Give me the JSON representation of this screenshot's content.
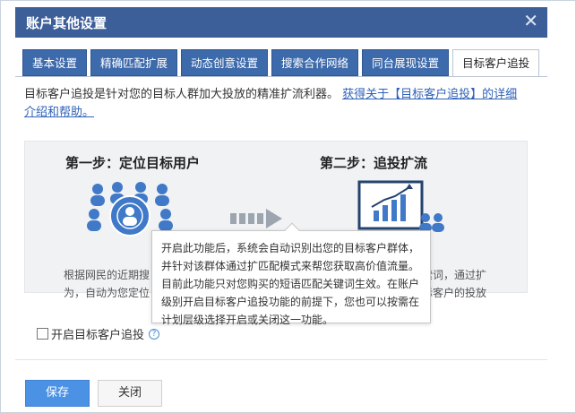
{
  "window": {
    "title": "账户其他设置",
    "close_glyph": "✕"
  },
  "tabs": [
    {
      "label": "基本设置",
      "active": false
    },
    {
      "label": "精确匹配扩展",
      "active": false
    },
    {
      "label": "动态创意设置",
      "active": false
    },
    {
      "label": "搜索合作网络",
      "active": false
    },
    {
      "label": "同台展现设置",
      "active": false
    },
    {
      "label": "目标客户追投",
      "active": true
    }
  ],
  "intro": {
    "text": "目标客户追投是针对您的目标人群加大投放的精准扩流利器。",
    "link": "获得关于【目标客户追投】的详细介绍和帮助。"
  },
  "steps": {
    "step1_title": "第一步：定位目标用户",
    "step2_title": "第二步：追投扩流",
    "left_desc_line1": "根据网民的近期搜",
    "left_desc_line2": "为，自动为您定位",
    "right_desc_line1": "索词，通过扩",
    "right_desc_line2": "标客户的投放"
  },
  "tooltip": {
    "lines": [
      "开启此功能后，系统会自动识别出您的目标客户群体，",
      "并针对该群体通过扩匹配模式来帮您获取高价值流量。",
      "目前此功能只对您购买的短语匹配关键词生效。在账户",
      "级别开启目标客户追投功能的前提下，您也可以按需在",
      "计划层级选择开启或关闭这一功能。"
    ]
  },
  "checkbox": {
    "label": "开启目标客户追投",
    "checked": false,
    "help_glyph": "?"
  },
  "buttons": {
    "save": "保存",
    "close": "关闭"
  },
  "colors": {
    "titlebar": "#3d5f99",
    "tab": "#3d6aab",
    "primary_button": "#4b92e5",
    "illustration_blue": "#3f79c8"
  }
}
